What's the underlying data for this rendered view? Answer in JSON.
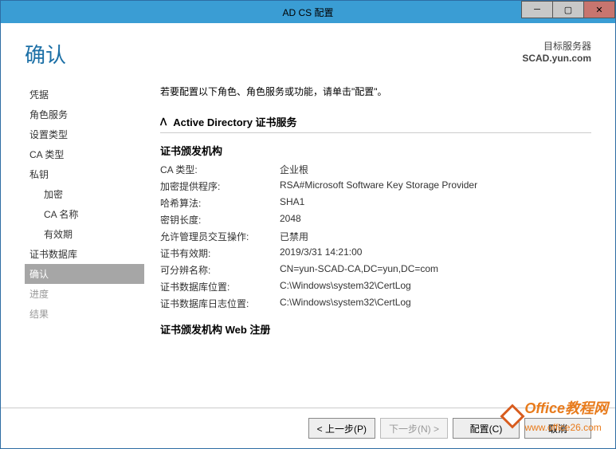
{
  "titlebar": {
    "title": "AD CS 配置"
  },
  "header": {
    "title": "确认",
    "target_label": "目标服务器",
    "target_server": "SCAD.yun.com"
  },
  "sidebar": {
    "items": [
      {
        "label": "凭据"
      },
      {
        "label": "角色服务"
      },
      {
        "label": "设置类型"
      },
      {
        "label": "CA 类型"
      },
      {
        "label": "私钥"
      },
      {
        "label": "加密"
      },
      {
        "label": "CA 名称"
      },
      {
        "label": "有效期"
      },
      {
        "label": "证书数据库"
      },
      {
        "label": "确认"
      },
      {
        "label": "进度"
      },
      {
        "label": "结果"
      }
    ]
  },
  "main": {
    "instruction": "若要配置以下角色、角色服务或功能，请单击\"配置\"。",
    "section_title": "Active Directory 证书服务",
    "group1_heading": "证书颁发机构",
    "group1": [
      {
        "k": "CA 类型:",
        "v": "企业根"
      },
      {
        "k": "加密提供程序:",
        "v": "RSA#Microsoft Software Key Storage Provider"
      },
      {
        "k": "哈希算法:",
        "v": "SHA1"
      },
      {
        "k": "密钥长度:",
        "v": "2048"
      },
      {
        "k": "允许管理员交互操作:",
        "v": "已禁用"
      },
      {
        "k": "证书有效期:",
        "v": "2019/3/31 14:21:00"
      },
      {
        "k": "可分辨名称:",
        "v": "CN=yun-SCAD-CA,DC=yun,DC=com"
      },
      {
        "k": "证书数据库位置:",
        "v": "C:\\Windows\\system32\\CertLog"
      },
      {
        "k": "证书数据库日志位置:",
        "v": "C:\\Windows\\system32\\CertLog"
      }
    ],
    "group2_heading": "证书颁发机构 Web 注册"
  },
  "footer": {
    "prev": "< 上一步(P)",
    "next": "下一步(N) >",
    "configure": "配置(C)",
    "cancel": "取消"
  },
  "watermark": {
    "brand": "Office教程网",
    "url": "www.office26.com"
  }
}
